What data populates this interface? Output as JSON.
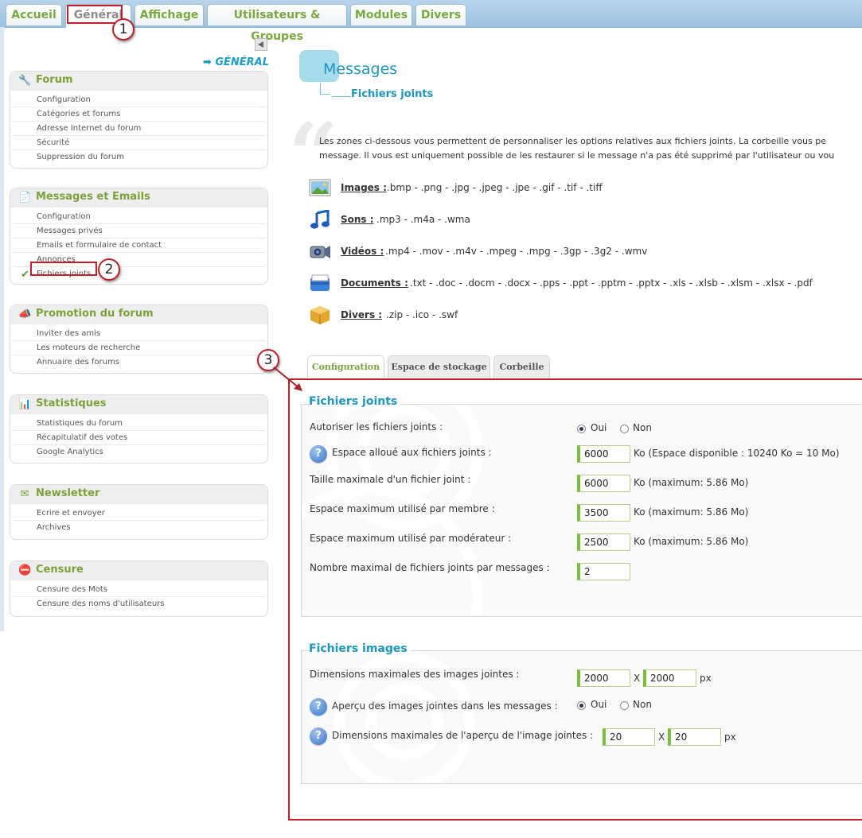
{
  "top_tabs": [
    "Accueil",
    "Général",
    "Affichage",
    "Utilisateurs & Groupes",
    "Modules",
    "Divers"
  ],
  "callouts": [
    "1",
    "2",
    "3"
  ],
  "sidebar": {
    "heading": "GÉNÉRAL",
    "sections": [
      {
        "title": "Forum",
        "icon": "wrench-icon",
        "items": [
          "Configuration",
          "Catégories et forums",
          "Adresse Internet du forum",
          "Sécurité",
          "Suppression du forum"
        ]
      },
      {
        "title": "Messages et Emails",
        "icon": "document-icon",
        "items": [
          "Configuration",
          "Messages privés",
          "Emails et formulaire de contact",
          "Annonces",
          "Fichiers joints"
        ]
      },
      {
        "title": "Promotion du forum",
        "icon": "megaphone-icon",
        "items": [
          "Inviter des amis",
          "Les moteurs de recherche",
          "Annuaire des forums"
        ]
      },
      {
        "title": "Statistiques",
        "icon": "pie-chart-icon",
        "items": [
          "Statistiques du forum",
          "Récapitulatif des votes",
          "Google Analytics"
        ]
      },
      {
        "title": "Newsletter",
        "icon": "envelope-icon",
        "items": [
          "Ecrire et envoyer",
          "Archives"
        ]
      },
      {
        "title": "Censure",
        "icon": "no-entry-icon",
        "items": [
          "Censure des Mots",
          "Censure des noms d'utilisateurs"
        ]
      }
    ]
  },
  "content": {
    "title": "Messages",
    "subtitle": "Fichiers joints",
    "intro_line1": "Les zones ci-dessous vous permettent de personnaliser les options relatives aux fichiers joints. La corbeille vous pe",
    "intro_line2": "message. Il vous est uniquement possible de les restaurer si le message n'a pas été supprimé par l'utilisateur ou vou",
    "file_types": [
      {
        "name": "Images :",
        "exts": ".bmp - .png - .jpg - .jpeg - .jpe - .gif - .tif - .tiff",
        "icon": "image-icon"
      },
      {
        "name": "Sons :",
        "exts": ".mp3 - .m4a - .wma",
        "icon": "music-note-icon"
      },
      {
        "name": "Vidéos :",
        "exts": ".mp4 - .mov - .m4v - .mpeg - .mpg - .3gp - .3g2 - .wmv",
        "icon": "video-camera-icon"
      },
      {
        "name": "Documents :",
        "exts": ".txt - .doc - .docm - .docx - .pps - .ppt - .pptm - .pptx - .xls - .xlsb - .xlsm - .xlsx - .pdf",
        "icon": "drawer-icon"
      },
      {
        "name": "Divers :",
        "exts": ".zip - .ico - .swf",
        "icon": "package-icon"
      }
    ],
    "config_tabs": [
      "Configuration",
      "Espace de stockage",
      "Corbeille"
    ]
  },
  "attachments": {
    "legend": "Fichiers joints",
    "allow_label": "Autoriser les fichiers joints :",
    "yes": "Oui",
    "no": "Non",
    "space_label": "Espace alloué aux fichiers joints :",
    "space_value": "6000",
    "space_note": "Ko (Espace disponible : 10240 Ko = 10 Mo)",
    "max_file_label": "Taille maximale d'un fichier joint :",
    "max_file_value": "6000",
    "max_file_note": "Ko (maximum: 5.86 Mo)",
    "member_label": "Espace maximum utilisé par membre :",
    "member_value": "3500",
    "member_note": "Ko (maximum: 5.86 Mo)",
    "moderator_label": "Espace maximum utilisé par modérateur :",
    "moderator_value": "2500",
    "moderator_note": "Ko (maximum: 5.86 Mo)",
    "count_label": "Nombre maximal de fichiers joints par messages :",
    "count_value": "2"
  },
  "images": {
    "legend": "Fichiers images",
    "dims_label": "Dimensions maximales des images jointes :",
    "dims_w": "2000",
    "dims_h": "2000",
    "x": "X",
    "px": "px",
    "preview_label": "Aperçu des images jointes dans les messages :",
    "yes": "Oui",
    "no": "Non",
    "preview_dims_label": "Dimensions maximales de l'aperçu de l'image jointes :",
    "preview_w": "20",
    "preview_h": "20"
  }
}
